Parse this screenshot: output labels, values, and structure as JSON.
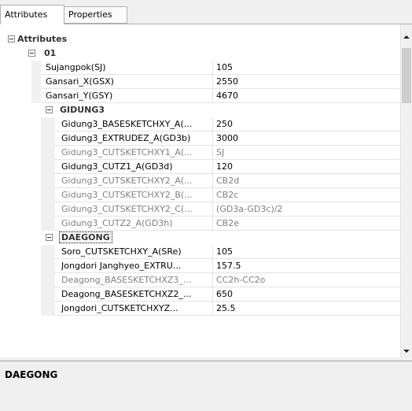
{
  "tabs": [
    {
      "label": "Attributes",
      "active": true
    },
    {
      "label": "Properties",
      "active": false
    }
  ],
  "grid": {
    "rows": [
      {
        "kind": "category",
        "level": 0,
        "label": "Attributes"
      },
      {
        "kind": "category",
        "level": 1,
        "label": "01"
      },
      {
        "kind": "property",
        "level": 1,
        "name": "Sujangpok(SJ)",
        "value": "105",
        "disabled": false
      },
      {
        "kind": "property",
        "level": 1,
        "name": "Gansari_X(GSX)",
        "value": "2550",
        "disabled": false
      },
      {
        "kind": "property",
        "level": 1,
        "name": "Gansari_Y(GSY)",
        "value": "4670",
        "disabled": false
      },
      {
        "kind": "category",
        "level": 2,
        "label": "GIDUNG3"
      },
      {
        "kind": "property",
        "level": 2,
        "name": "Gidung3_BASESKETCHXY_A(...",
        "value": "250",
        "disabled": false
      },
      {
        "kind": "property",
        "level": 2,
        "name": "Gidung3_EXTRUDEZ_A(GD3b)",
        "value": "3000",
        "disabled": false
      },
      {
        "kind": "property",
        "level": 2,
        "name": "Gidung3_CUTSKETCHXY1_A(...",
        "value": "SJ",
        "disabled": true
      },
      {
        "kind": "property",
        "level": 2,
        "name": "Gidung3_CUTZ1_A(GD3d)",
        "value": "120",
        "disabled": false
      },
      {
        "kind": "property",
        "level": 2,
        "name": "Gidung3_CUTSKETCHXY2_A(...",
        "value": "CB2d",
        "disabled": true
      },
      {
        "kind": "property",
        "level": 2,
        "name": "Gidung3_CUTSKETCHXY2_B(...",
        "value": "CB2c",
        "disabled": true
      },
      {
        "kind": "property",
        "level": 2,
        "name": "Gidung3_CUTSKETCHXY2_C(...",
        "value": "(GD3a-GD3c)/2",
        "disabled": true
      },
      {
        "kind": "property",
        "level": 2,
        "name": "Gidung3_CUTZ2_A(GD3h)",
        "value": "CB2e",
        "disabled": true
      },
      {
        "kind": "category",
        "level": 2,
        "label": "DAEGONG",
        "selected": true
      },
      {
        "kind": "property",
        "level": 2,
        "name": "Soro_CUTSKETCHXY_A(SRe)",
        "value": "105",
        "disabled": false
      },
      {
        "kind": "property",
        "level": 2,
        "name": "Jongdori Janghyeo_EXTRU...",
        "value": "157.5",
        "disabled": false
      },
      {
        "kind": "property",
        "level": 2,
        "name": "Deagong_BASESKETCHXZ3_...",
        "value": "CC2h-CC2o",
        "disabled": true
      },
      {
        "kind": "property",
        "level": 2,
        "name": "Deagong_BASESKETCHXZ2_...",
        "value": "650",
        "disabled": false
      },
      {
        "kind": "property",
        "level": 2,
        "name": "Jongdori_CUTSKETCHXYZ...",
        "value": "25.5",
        "disabled": false
      }
    ]
  },
  "description": {
    "title": "DAEGONG"
  }
}
